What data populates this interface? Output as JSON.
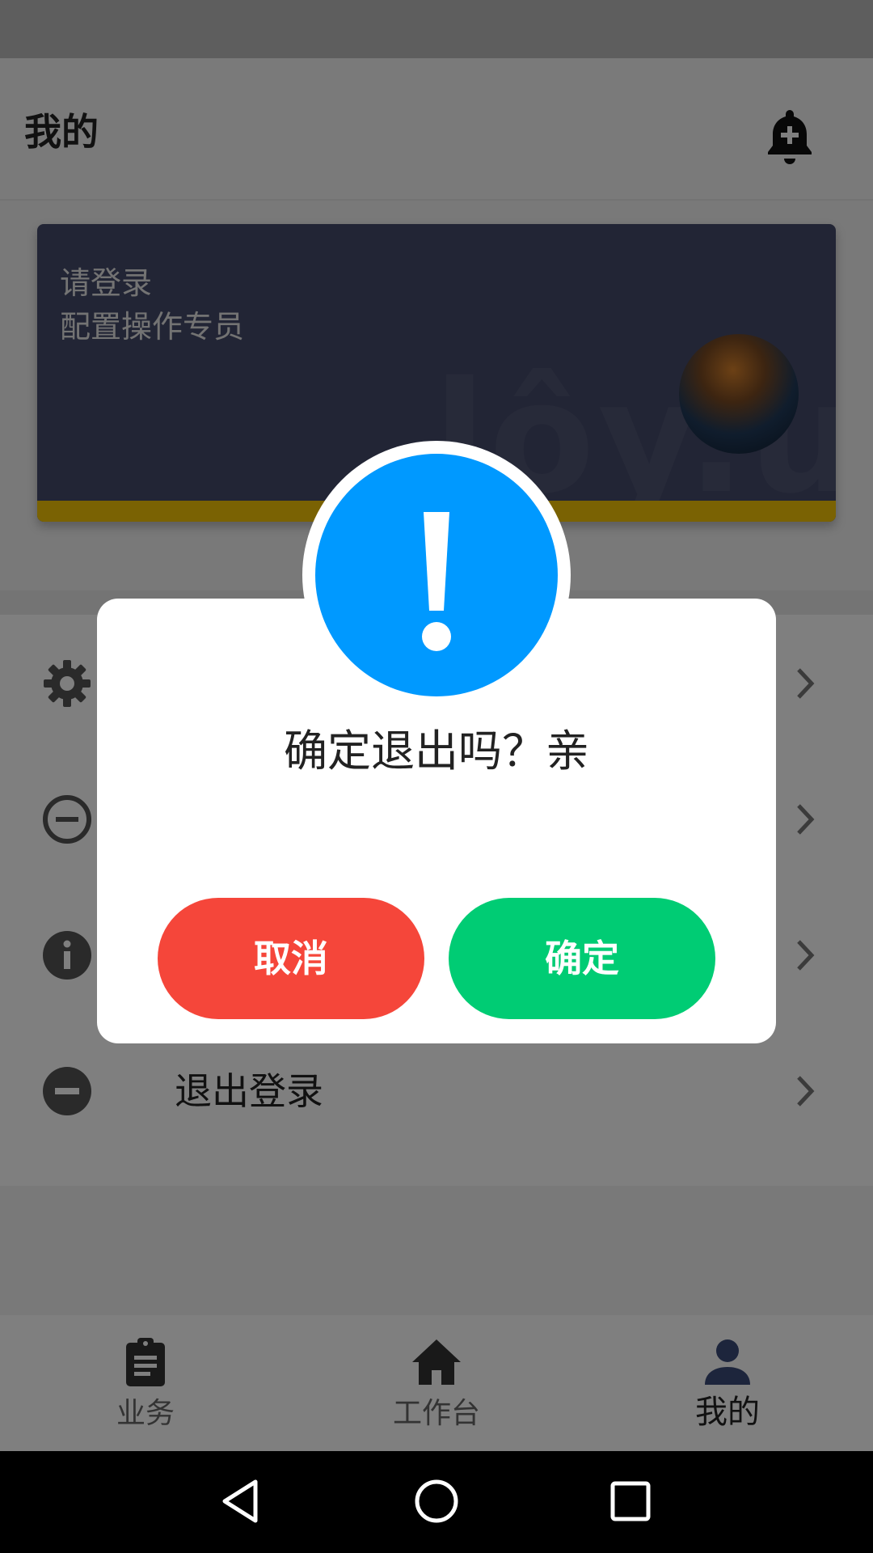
{
  "header": {
    "title": "我的"
  },
  "profile_card": {
    "line1": "请登录",
    "line2": "配置操作专员",
    "watermark": "lôy.u",
    "accent_color": "#f5c406"
  },
  "menu": {
    "items": [
      {
        "icon": "gear-icon",
        "label": ""
      },
      {
        "icon": "minus-circle-outline-icon",
        "label": ""
      },
      {
        "icon": "info-icon",
        "label": ""
      },
      {
        "icon": "minus-circle-filled-icon",
        "label": "退出登录"
      }
    ]
  },
  "bottom_nav": {
    "items": [
      {
        "icon": "clipboard-icon",
        "label": "业务"
      },
      {
        "icon": "home-icon",
        "label": "工作台"
      },
      {
        "icon": "person-icon",
        "label": "我的",
        "active": true
      }
    ]
  },
  "dialog": {
    "icon": "exclamation-icon",
    "icon_color": "#0099ff",
    "message": "确定退出吗？亲",
    "cancel_label": "取消",
    "confirm_label": "确定",
    "cancel_color": "#f5463a",
    "confirm_color": "#00cc74"
  }
}
